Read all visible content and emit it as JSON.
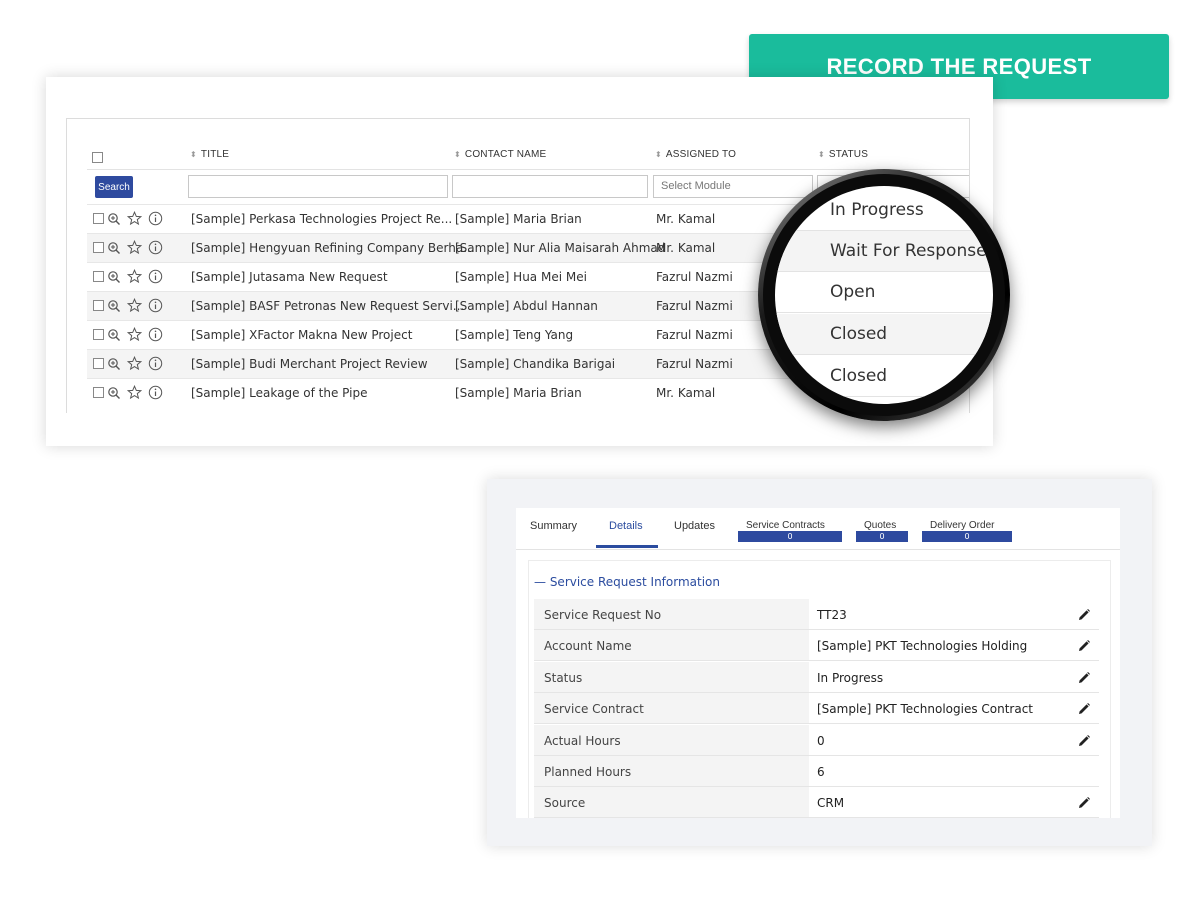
{
  "cta": {
    "label": "RECORD THE REQUEST",
    "color": "#1abc9c"
  },
  "list": {
    "columns": {
      "title": "TITLE",
      "contact": "CONTACT NAME",
      "assigned": "ASSIGNED TO",
      "status": "STATUS"
    },
    "search_label": "Search",
    "assigned_filter_placeholder": "Select Module",
    "rows": [
      {
        "title": "[Sample] Perkasa Technologies Project Re...",
        "contact": "[Sample] Maria Brian",
        "assigned": "Mr. Kamal"
      },
      {
        "title": "[Sample] Hengyuan Refining Company Berha...",
        "contact": "[Sample] Nur Alia Maisarah Ahmad",
        "assigned": "Mr. Kamal"
      },
      {
        "title": "[Sample] Jutasama New Request",
        "contact": "[Sample] Hua Mei Mei",
        "assigned": "Fazrul Nazmi"
      },
      {
        "title": "[Sample] BASF Petronas New Request Servi...",
        "contact": "[Sample] Abdul Hannan",
        "assigned": "Fazrul Nazmi"
      },
      {
        "title": "[Sample] XFactor Makna New Project",
        "contact": "[Sample] Teng Yang",
        "assigned": "Fazrul Nazmi"
      },
      {
        "title": "[Sample] Budi Merchant Project Review",
        "contact": "[Sample] Chandika Barigai",
        "assigned": "Fazrul Nazmi"
      },
      {
        "title": "[Sample] Leakage of the Pipe",
        "contact": "[Sample] Maria Brian",
        "assigned": "Mr. Kamal"
      }
    ]
  },
  "status_magnified": [
    "In Progress",
    "Wait For Response",
    "Open",
    "Closed",
    "Closed"
  ],
  "detail": {
    "tabs": [
      {
        "label": "Summary"
      },
      {
        "label": "Details",
        "active": true
      },
      {
        "label": "Updates"
      },
      {
        "label": "Service Contracts",
        "count": "0"
      },
      {
        "label": "Quotes",
        "count": "0"
      },
      {
        "label": "Delivery Order",
        "count": "0"
      }
    ],
    "section_title": "— Service Request Information",
    "fields": [
      {
        "label": "Service Request No",
        "value": "TT23",
        "editable": true
      },
      {
        "label": "Account Name",
        "value": "[Sample] PKT Technologies Holding",
        "editable": true
      },
      {
        "label": "Status",
        "value": "In Progress",
        "editable": true
      },
      {
        "label": "Service Contract",
        "value": "[Sample] PKT Technologies Contract",
        "editable": true
      },
      {
        "label": "Actual Hours",
        "value": "0",
        "editable": true
      },
      {
        "label": "Planned Hours",
        "value": "6",
        "editable": false
      },
      {
        "label": "Source",
        "value": "CRM",
        "editable": true
      }
    ],
    "accent_color": "#2b4c9f"
  }
}
